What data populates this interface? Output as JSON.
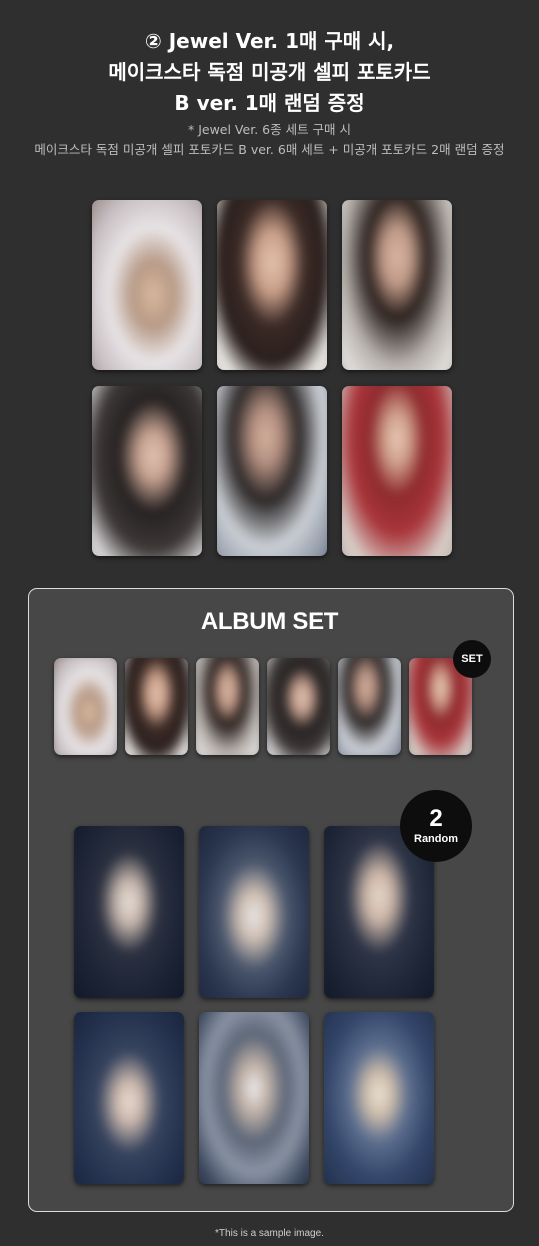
{
  "header": {
    "line1": "② Jewel Ver. 1매 구매 시,",
    "line2": "메이크스타 독점 미공개 셀피 포토카드",
    "line3": "B ver. 1매 랜덤 증정"
  },
  "note": {
    "line1": "* Jewel Ver. 6종 세트 구매 시",
    "line2": "메이크스타 독점 미공개 셀피 포토카드 B ver. 6매 세트 + 미공개 포토카드 2매 랜덤 증정"
  },
  "album_set": {
    "title": "ALBUM SET",
    "set_badge": "SET",
    "random_badge_count": "2",
    "random_badge_label": "Random"
  },
  "footnote": "*This is a sample image.",
  "palette": {
    "background": "#2f2f2f",
    "panel": "#474747",
    "panel_border": "#dcdcdc",
    "badge": "#0d0d0d"
  },
  "selfie_cards": [
    {
      "name": "selfie-card-1",
      "bg": "radial-gradient(ellipse at 55% 55%, #d9b89e 0%, #b79a86 22%, #e8e4e6 45%, #c8c0c4 70%, #8a7a74 100%)"
    },
    {
      "name": "selfie-card-2",
      "bg": "radial-gradient(ellipse at 50% 38%, #e3c3ae 0%, #caa08a 18%, #3b2a26 38%, #2a1f1c 60%, #e9e6e3 80%, #cfc7c0 100%)"
    },
    {
      "name": "selfie-card-3",
      "bg": "radial-gradient(ellipse at 50% 35%, #d9b5a2 0%, #c09a88 16%, #2a201d 35%, #b8b2ad 62%, #e2e0de 85%, #9a948f 100%)"
    },
    {
      "name": "selfie-card-4",
      "bg": "radial-gradient(ellipse at 55% 42%, #e1c2b1 0%, #c7a291 15%, #262222 36%, #3d3837 60%, #d8d6d8 82%, #b5b3b6 100%)"
    },
    {
      "name": "selfie-card-5",
      "bg": "radial-gradient(ellipse at 45% 32%, #d4b09e 0%, #b38f80 15%, #2a2626 35%, #ccd0d6 60%, #8f97a6 85%, #5b6270 100%)"
    },
    {
      "name": "selfie-card-6",
      "bg": "radial-gradient(ellipse at 50% 33%, #e8c8b6 0%, #cfa08c 14%, #8e2a2e 32%, #a8353a 52%, #d9cfc9 78%, #b6aaa2 100%)"
    }
  ],
  "set_cards": [
    {
      "name": "set-card-1",
      "bg": "radial-gradient(ellipse at 55% 55%, #d9b89e 0%, #b79a86 22%, #e8e4e6 45%, #c8c0c4 70%, #8a7a74 100%)"
    },
    {
      "name": "set-card-2",
      "bg": "radial-gradient(ellipse at 50% 38%, #e3c3ae 0%, #caa08a 18%, #3b2a26 38%, #2a1f1c 60%, #e9e6e3 80%, #cfc7c0 100%)"
    },
    {
      "name": "set-card-3",
      "bg": "radial-gradient(ellipse at 50% 35%, #d9b5a2 0%, #c09a88 16%, #2a201d 35%, #b8b2ad 62%, #e2e0de 85%, #9a948f 100%)"
    },
    {
      "name": "set-card-4",
      "bg": "radial-gradient(ellipse at 55% 42%, #e1c2b1 0%, #c7a291 15%, #262222 36%, #3d3837 60%, #d8d6d8 82%, #b5b3b6 100%)"
    },
    {
      "name": "set-card-5",
      "bg": "radial-gradient(ellipse at 45% 32%, #d4b09e 0%, #b38f80 15%, #2a2626 35%, #ccd0d6 60%, #8f97a6 85%, #5b6270 100%)"
    },
    {
      "name": "set-card-6",
      "bg": "radial-gradient(ellipse at 50% 33%, #e8c8b6 0%, #cfa08c 14%, #8e2a2e 32%, #a8353a 52%, #d9cfc9 78%, #b6aaa2 100%)"
    }
  ],
  "random_cards": [
    {
      "name": "random-card-1",
      "bg": "radial-gradient(ellipse at 50% 45%, #e6ded8 0%, #c8b8ae 14%, #2c3140 34%, #1c2436 60%, #0f1524 100%)"
    },
    {
      "name": "random-card-2",
      "bg": "radial-gradient(ellipse at 50% 52%, #e7e5e6 0%, #d0c0b4 16%, #4a566c 38%, #2b3750 62%, #192236 100%)"
    },
    {
      "name": "random-card-3",
      "bg": "radial-gradient(ellipse at 50% 42%, #e4d6cc 0%, #cdb7a8 15%, #2e3547 36%, #1e2638 62%, #0f1522 100%)"
    },
    {
      "name": "random-card-4",
      "bg": "radial-gradient(ellipse at 50% 52%, #e8dbd1 0%, #cdb9ad 14%, #37445e 36%, #253350 62%, #162036 100%)"
    },
    {
      "name": "random-card-5",
      "bg": "radial-gradient(ellipse at 50% 45%, #ecebec 0%, #c2b2a8 16%, #5c6678 36%, #8a94a4 56%, #3a465c 80%, #222c40 100%)"
    },
    {
      "name": "random-card-6",
      "bg": "radial-gradient(ellipse at 50% 48%, #e7e1d8 0%, #d2c0ac 14%, #5c6e8e 34%, #33466a 60%, #1d2a44 100%)"
    }
  ]
}
